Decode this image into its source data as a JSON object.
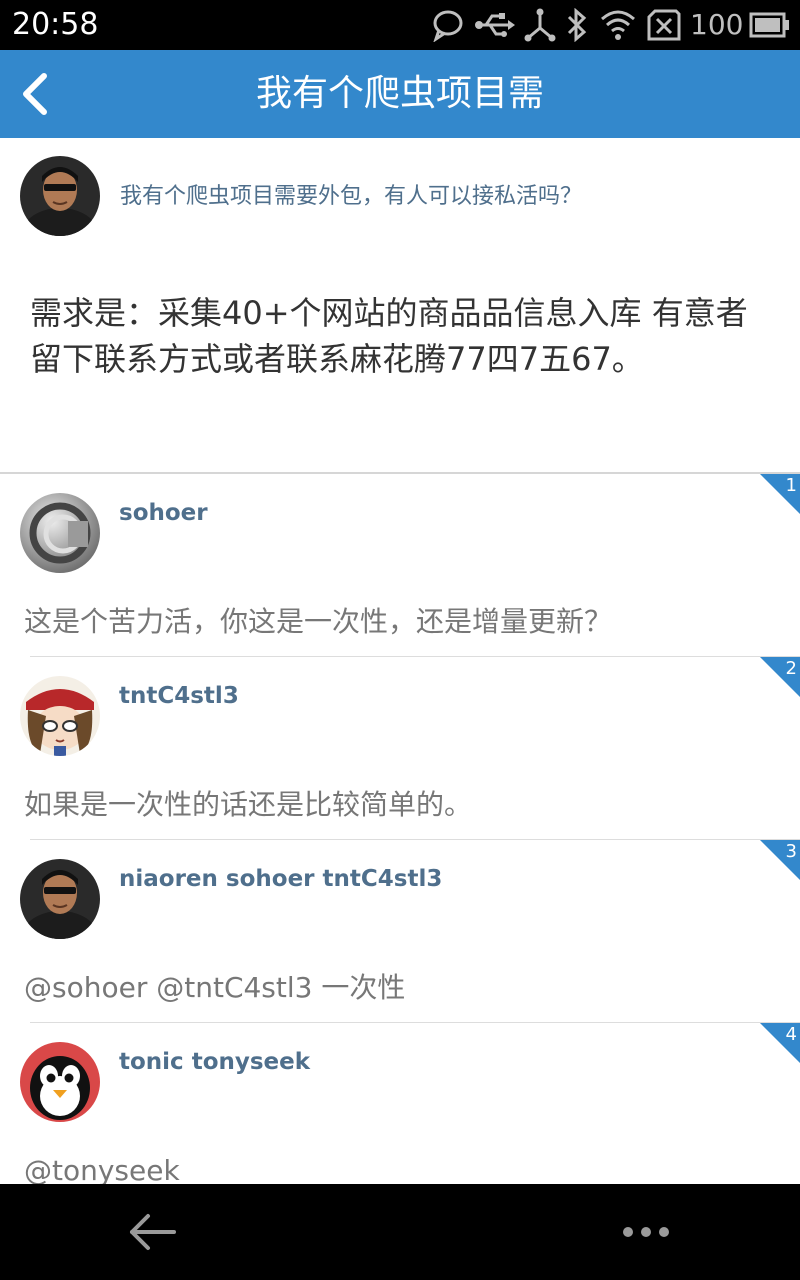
{
  "status_bar": {
    "time": "20:58",
    "battery": "100",
    "icons": [
      "chat-bubble-icon",
      "usb-icon",
      "usb-debug-icon",
      "bluetooth-icon",
      "wifi-icon",
      "no-sim-icon",
      "battery-icon"
    ]
  },
  "header": {
    "title": "我有个爬虫项目需",
    "back_icon": "chevron-left-icon",
    "color": "#3388cc"
  },
  "post": {
    "title": "我有个爬虫项目需要外包，有人可以接私活吗？",
    "body": "需求是：采集40+个网站的商品品信息入库 有意者留下联系方式或者联系麻花腾77四7五67。"
  },
  "replies": [
    {
      "floor": "1",
      "name": "sohoer",
      "text": "这是个苦力活，你这是一次性，还是增量更新？"
    },
    {
      "floor": "2",
      "name": "tntC4stl3",
      "text": "如果是一次性的话还是比较简单的。"
    },
    {
      "floor": "3",
      "name": "niaoren sohoer tntC4stl3",
      "text": "@sohoer @tntC4stl3 一次性"
    },
    {
      "floor": "4",
      "name": "tonic tonyseek",
      "text": "@tonyseek"
    }
  ],
  "nav_bar": {
    "back_icon": "back-arrow-icon",
    "more_icon": "more-dots-icon"
  }
}
